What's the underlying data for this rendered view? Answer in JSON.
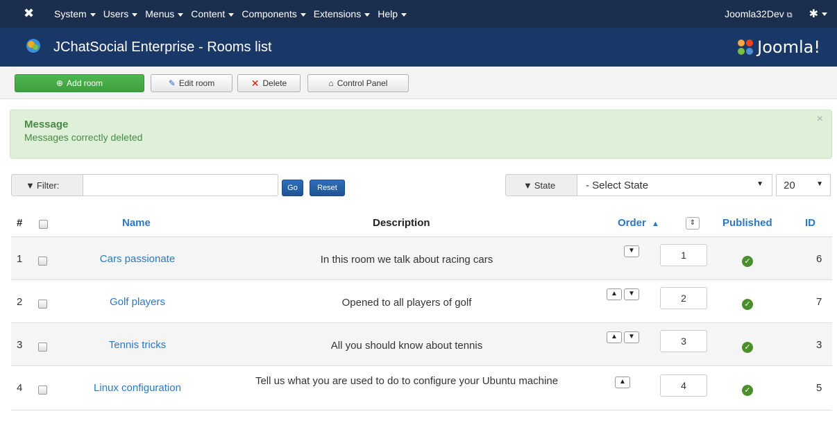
{
  "navbar": {
    "menu": [
      "System",
      "Users",
      "Menus",
      "Content",
      "Components",
      "Extensions",
      "Help"
    ],
    "site_name": "Joomla32Dev"
  },
  "header": {
    "title": "JChatSocial Enterprise - Rooms list",
    "brand": "Joomla!"
  },
  "toolbar": {
    "add_label": "Add room",
    "edit_label": "Edit room",
    "delete_label": "Delete",
    "control_panel_label": "Control Panel"
  },
  "message": {
    "heading": "Message",
    "text": "Messages correctly deleted"
  },
  "filters": {
    "filter_label": "Filter:",
    "filter_value": "",
    "go_label": "Go",
    "reset_label": "Reset",
    "state_label": "State",
    "state_selected": "- Select State",
    "limit_selected": "20"
  },
  "table": {
    "headers": {
      "num": "#",
      "name": "Name",
      "description": "Description",
      "order": "Order",
      "published": "Published",
      "id": "ID"
    },
    "rows": [
      {
        "num": "1",
        "name": "Cars passionate",
        "description": "In this room we talk about racing cars",
        "order": "1",
        "published": true,
        "id": "6",
        "up": false,
        "down": true
      },
      {
        "num": "2",
        "name": "Golf players",
        "description": "Opened to all players of golf",
        "order": "2",
        "published": true,
        "id": "7",
        "up": true,
        "down": true
      },
      {
        "num": "3",
        "name": "Tennis tricks",
        "description": "All you should know about tennis",
        "order": "3",
        "published": true,
        "id": "3",
        "up": true,
        "down": true
      },
      {
        "num": "4",
        "name": "Linux configuration",
        "description": "Tell us what you are used to do to configure your Ubuntu machine",
        "order": "4",
        "published": true,
        "id": "5",
        "up": true,
        "down": false
      }
    ]
  },
  "colors": {
    "navbar_bg": "#1b2e4d",
    "header_bg": "#1a3867",
    "success": "#46a546",
    "link": "#2a78c2",
    "alert_bg": "#dff0d8",
    "published_icon": "#4a8f2c"
  }
}
